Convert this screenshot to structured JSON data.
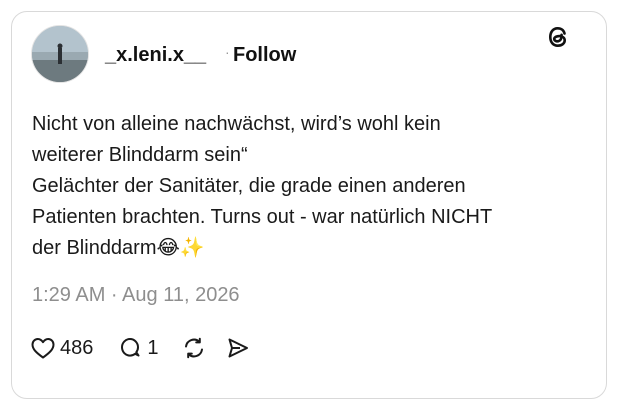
{
  "post": {
    "username": "_x.leni.x__",
    "separator": "·",
    "follow_label": "Follow",
    "lines": [
      "Nicht von alleine nachwächst, wird’s wohl kein",
      "weiterer Blinddarm sein“",
      "Gelächter der Sanitäter, die grade einen anderen",
      "Patienten brachten. Turns out - war natürlich NICHT",
      "der Blinddarm😂✨"
    ],
    "timestamp": "1:29 AM · Aug 11, 2026",
    "likes": "486",
    "replies": "1"
  },
  "icons": {
    "logo": "threads-logo-icon",
    "like": "heart-icon",
    "reply": "speech-bubble-icon",
    "repost": "repost-icon",
    "share": "send-icon"
  },
  "colors": {
    "text": "#1a1a1a",
    "muted": "#8e8e8e",
    "border": "#d9d9d9"
  }
}
